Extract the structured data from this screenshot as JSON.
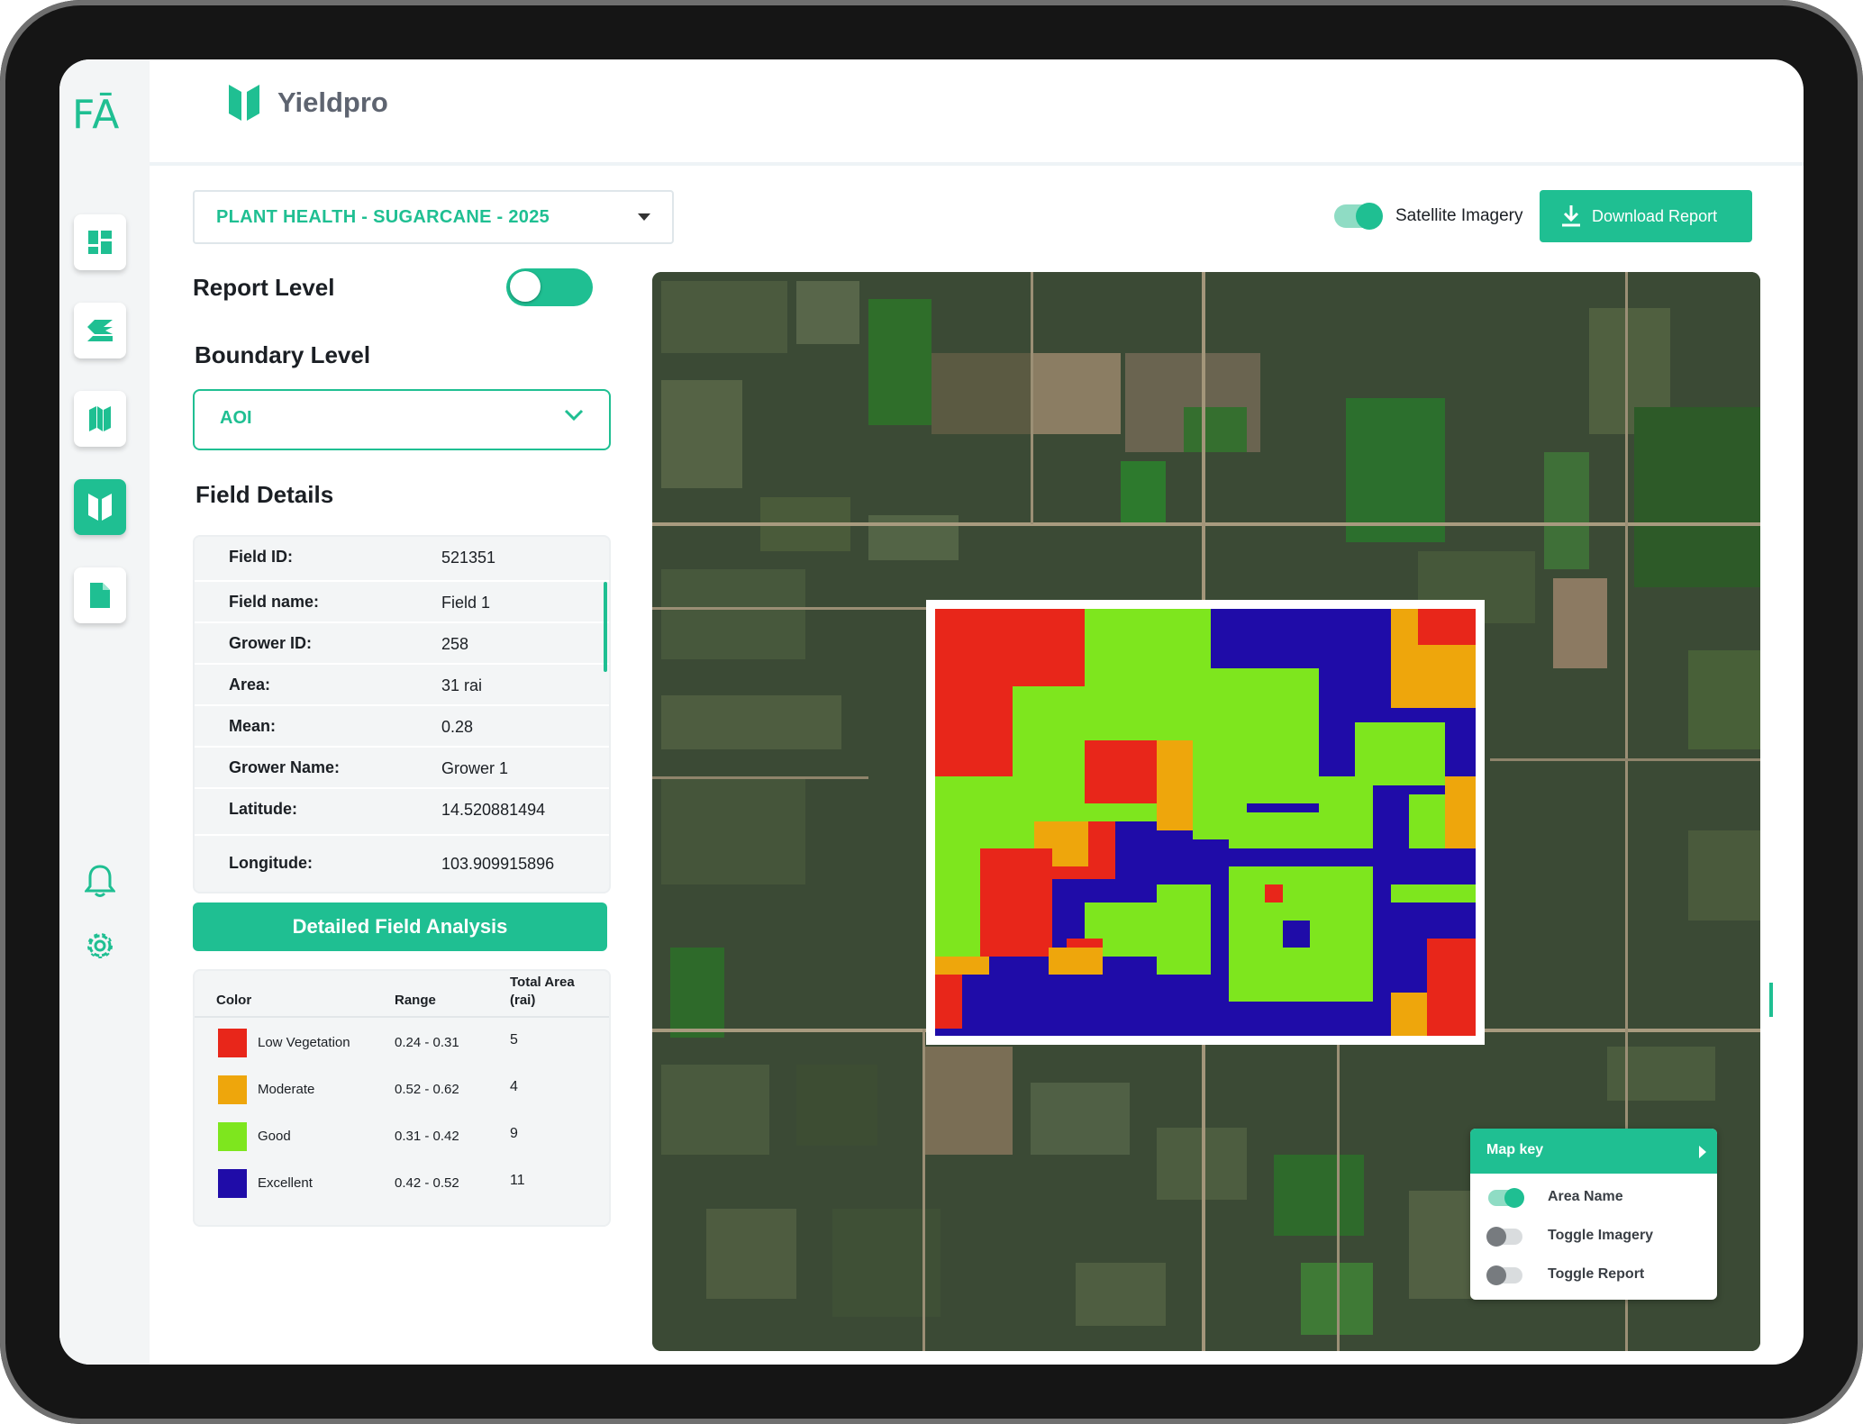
{
  "app": {
    "logo_text": "FĀ",
    "brand_name": "Yieldpro"
  },
  "sidebar": {
    "items": [
      {
        "name": "dashboard",
        "icon": "dashboard-icon"
      },
      {
        "name": "layers",
        "icon": "layers-icon"
      },
      {
        "name": "map",
        "icon": "map-icon"
      },
      {
        "name": "yieldpro",
        "icon": "yieldpro-icon",
        "active": true
      },
      {
        "name": "documents",
        "icon": "document-icon"
      }
    ],
    "bottom": [
      {
        "icon": "bell-icon"
      },
      {
        "icon": "gear-icon"
      }
    ]
  },
  "report_select": {
    "value": "PLANT HEALTH - SUGARCANE - 2025"
  },
  "report_level": {
    "label": "Report Level",
    "enabled": true
  },
  "boundary_level": {
    "label": "Boundary Level",
    "value": "AOI"
  },
  "field_details": {
    "title": "Field Details",
    "rows": [
      {
        "key": "Field ID:",
        "value": "521351"
      },
      {
        "key": "Field name:",
        "value": "Field 1"
      },
      {
        "key": "Grower ID:",
        "value": "258"
      },
      {
        "key": "Area:",
        "value": "31 rai"
      },
      {
        "key": "Mean:",
        "value": "0.28"
      },
      {
        "key": "Grower Name:",
        "value": "Grower 1"
      },
      {
        "key": "Latitude:",
        "value": "14.520881494"
      },
      {
        "key": "Longitude:",
        "value": "103.909915896"
      }
    ]
  },
  "analysis_button": {
    "label": "Detailed Field Analysis"
  },
  "legend": {
    "headers": {
      "color": "Color",
      "range": "Range",
      "area_line1": "Total Area",
      "area_line2": "(rai)"
    },
    "rows": [
      {
        "name": "Low Vegetation",
        "range": "0.24 - 0.31",
        "area": "5",
        "color": "#e8261a"
      },
      {
        "name": "Moderate",
        "range": "0.52 - 0.62",
        "area": "4",
        "color": "#eea60c"
      },
      {
        "name": "Good",
        "range": "0.31 - 0.42",
        "area": "9",
        "color": "#7ee61e"
      },
      {
        "name": "Excellent",
        "range": "0.42 - 0.52",
        "area": "11",
        "color": "#1f0ca8"
      }
    ]
  },
  "toolbar": {
    "satellite_label": "Satellite Imagery",
    "satellite_on": true,
    "download_label": "Download Report"
  },
  "map_key": {
    "title": "Map key",
    "items": [
      {
        "label": "Area Name",
        "on": true
      },
      {
        "label": "Toggle Imagery",
        "on": false
      },
      {
        "label": "Toggle Report",
        "on": false
      }
    ]
  },
  "colors": {
    "accent": "#1fbf92",
    "text": "#1b1f24"
  }
}
